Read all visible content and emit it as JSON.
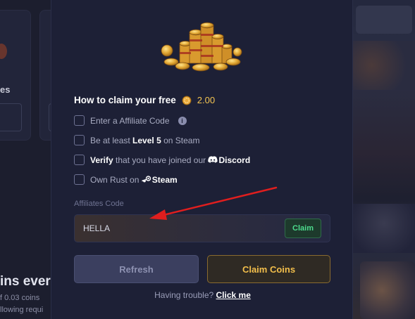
{
  "background": {
    "left_fragment_1": "es",
    "left_heading_fragment": "ins ever",
    "left_text_fragment_1": "f 0.03 coins",
    "left_text_fragment_2": "llowing requi"
  },
  "modal": {
    "title": "How to claim your free",
    "reward_amount": "2.00",
    "requirements": [
      {
        "pre": "Enter a Affiliate Code",
        "bold": "",
        "post": ""
      },
      {
        "pre": "Be at least ",
        "bold": "Level 5",
        "post": " on Steam"
      },
      {
        "pre": "",
        "bold": "Verify",
        "post": " that you have joined our "
      },
      {
        "pre": "Own Rust on ",
        "bold": "Steam",
        "post": ""
      }
    ],
    "discord_label": "Discord",
    "affiliate_field": {
      "label": "Affiliates Code",
      "value": "HELLA",
      "claim_label": "Claim"
    },
    "refresh_label": "Refresh",
    "claim_coins_label": "Claim Coins",
    "trouble_text": "Having trouble?",
    "trouble_link": "Click me"
  },
  "icons": {
    "coin_pile": "coin-pile-icon",
    "coin": "coin-icon",
    "info": "info-icon",
    "discord": "discord-icon",
    "steam": "steam-icon"
  },
  "colors": {
    "modal_bg": "#1d2036",
    "gold": "#f2be4b",
    "green": "#4ddc8d",
    "annotation_arrow": "#e01e1e"
  }
}
